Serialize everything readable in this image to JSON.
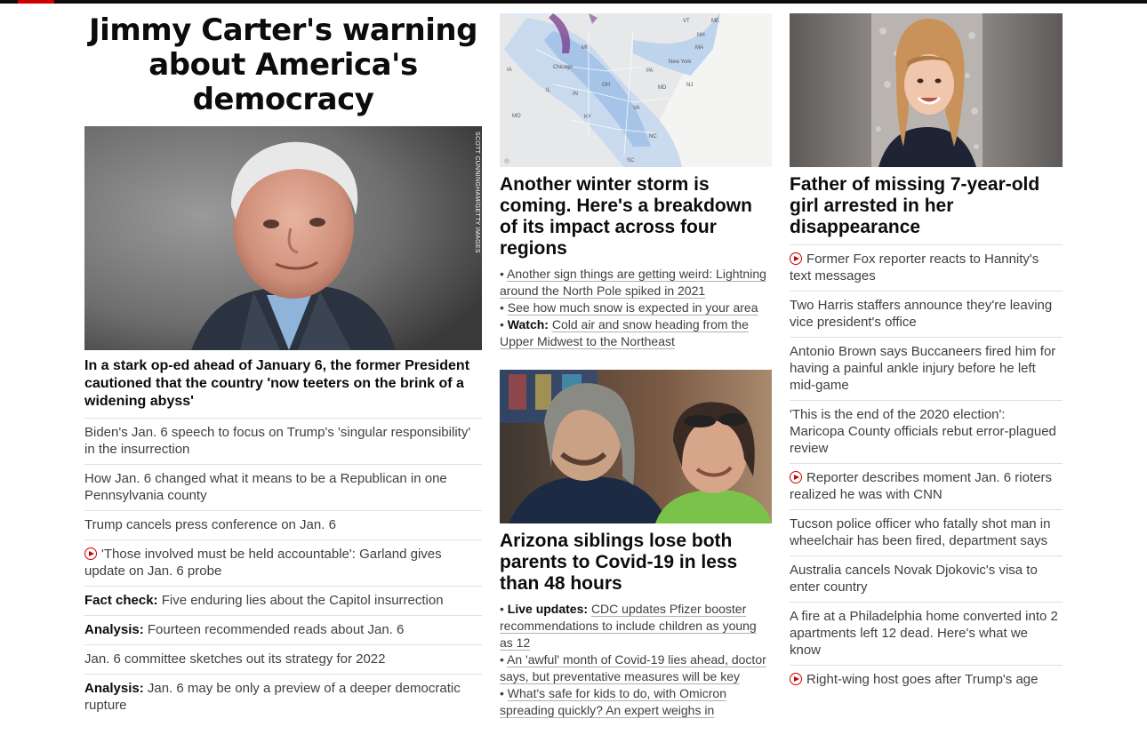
{
  "colors": {
    "brand_red": "#cc0000",
    "top_bar": "#0c0c0c",
    "divider": "#e0e0e0"
  },
  "main": {
    "title": "Jimmy Carter's warning about America's democracy",
    "image_credit": "SCOTT CUNNINGHAM/GETTY IMAGES",
    "lead": "In a stark op-ed ahead of January 6, the former President cautioned that the country 'now teeters on the brink of a widening abyss'",
    "items": [
      {
        "prefix": "",
        "text": "Biden's Jan. 6 speech to focus on Trump's 'singular responsibility' in the insurrection",
        "video": false
      },
      {
        "prefix": "",
        "text": "How Jan. 6 changed what it means to be a Republican in one Pennsylvania county",
        "video": false
      },
      {
        "prefix": "",
        "text": "Trump cancels press conference on Jan. 6",
        "video": false
      },
      {
        "prefix": "",
        "text": "'Those involved must be held accountable': Garland gives update on Jan. 6 probe",
        "video": true
      },
      {
        "prefix": "Fact check:",
        "text": " Five enduring lies about the Capitol insurrection",
        "video": false
      },
      {
        "prefix": "Analysis:",
        "text": " Fourteen recommended reads about Jan. 6",
        "video": false
      },
      {
        "prefix": "",
        "text": "Jan. 6 committee sketches out its strategy for 2022",
        "video": false
      },
      {
        "prefix": "Analysis:",
        "text": " Jan. 6 may be only a preview of a deeper democratic rupture",
        "video": false
      }
    ]
  },
  "storm": {
    "headline": "Another winter storm is coming. Here's a breakdown of its impact across four regions",
    "map_labels": [
      "Chicago",
      "New York",
      "MI",
      "IA",
      "IL",
      "IN",
      "OH",
      "PA",
      "NJ",
      "MD",
      "KY",
      "VA",
      "NC",
      "SC",
      "MO",
      "ME",
      "NH",
      "VT",
      "MA"
    ],
    "bullets": [
      {
        "prefix": "",
        "text": "Another sign things are getting weird: Lightning around the North Pole spiked in 2021"
      },
      {
        "prefix": "",
        "text": "See how much snow is expected in your area"
      },
      {
        "prefix": "Watch:",
        "text": "Cold air and snow heading from the Upper Midwest to the Northeast"
      }
    ]
  },
  "covid": {
    "headline": "Arizona siblings lose both parents to Covid-19 in less than 48 hours",
    "bullets": [
      {
        "prefix": "Live updates:",
        "text": "CDC updates Pfizer booster recommendations to include children as young as 12"
      },
      {
        "prefix": "",
        "text": "An 'awful' month of Covid-19 lies ahead, doctor says, but preventative measures will be key"
      },
      {
        "prefix": "",
        "text": "What's safe for kids to do, with Omicron spreading quickly? An expert weighs in"
      }
    ]
  },
  "missing": {
    "headline": "Father of missing 7-year-old girl arrested in her disappearance",
    "items": [
      {
        "text": "Former Fox reporter reacts to Hannity's text messages",
        "video": true
      },
      {
        "text": "Two Harris staffers announce they're leaving vice president's office",
        "video": false
      },
      {
        "text": "Antonio Brown says Buccaneers fired him for having a painful ankle injury before he left mid-game",
        "video": false
      },
      {
        "text": "'This is the end of the 2020 election': Maricopa County officials rebut error-plagued review",
        "video": false
      },
      {
        "text": "Reporter describes moment Jan. 6 rioters realized he was with CNN",
        "video": true
      },
      {
        "text": "Tucson police officer who fatally shot man in wheelchair has been fired, department says",
        "video": false
      },
      {
        "text": "Australia cancels Novak Djokovic's visa to enter country",
        "video": false
      },
      {
        "text": "A fire at a Philadelphia home converted into 2 apartments left 12 dead. Here's what we know",
        "video": false
      },
      {
        "text": "Right-wing host goes after Trump's age",
        "video": true
      }
    ]
  }
}
